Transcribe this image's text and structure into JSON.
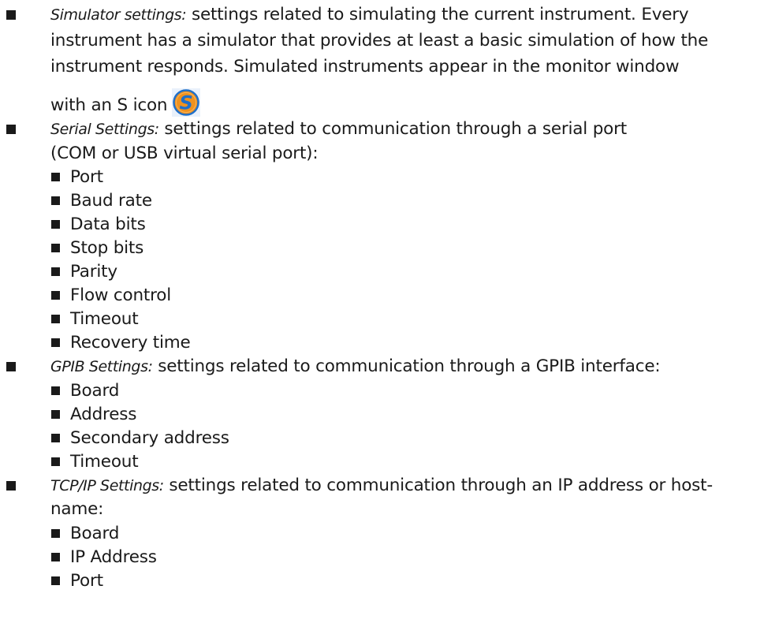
{
  "sections": [
    {
      "term": "Simulator settings:",
      "lines": [
        " settings related to simulating the current instrument. Every",
        "instrument has a simulator that provides at least a basic simulation of how the",
        "instrument responds. Simulated instruments appear in the monitor window",
        "with an S icon"
      ],
      "icon": "simulator-s-icon"
    },
    {
      "term": "Serial Settings:",
      "lines": [
        " settings related to communication through a serial port",
        "(COM or USB virtual serial port):"
      ],
      "items": [
        "Port",
        "Baud rate",
        "Data bits",
        "Stop bits",
        "Parity",
        "Flow control",
        "Timeout",
        "Recovery time"
      ]
    },
    {
      "term": "GPIB Settings:",
      "lines": [
        " settings related to communication through a GPIB interface:"
      ],
      "items": [
        "Board",
        "Address",
        "Secondary address",
        "Timeout"
      ]
    },
    {
      "term": "TCP/IP Settings:",
      "lines": [
        " settings related to communication through an IP address or host-",
        "name:"
      ],
      "items": [
        "Board",
        "IP Address",
        "Port"
      ]
    }
  ],
  "colors": {
    "text": "#1a1a1a",
    "icon_fill": "#f0921e",
    "icon_border": "#1f6fc9"
  }
}
